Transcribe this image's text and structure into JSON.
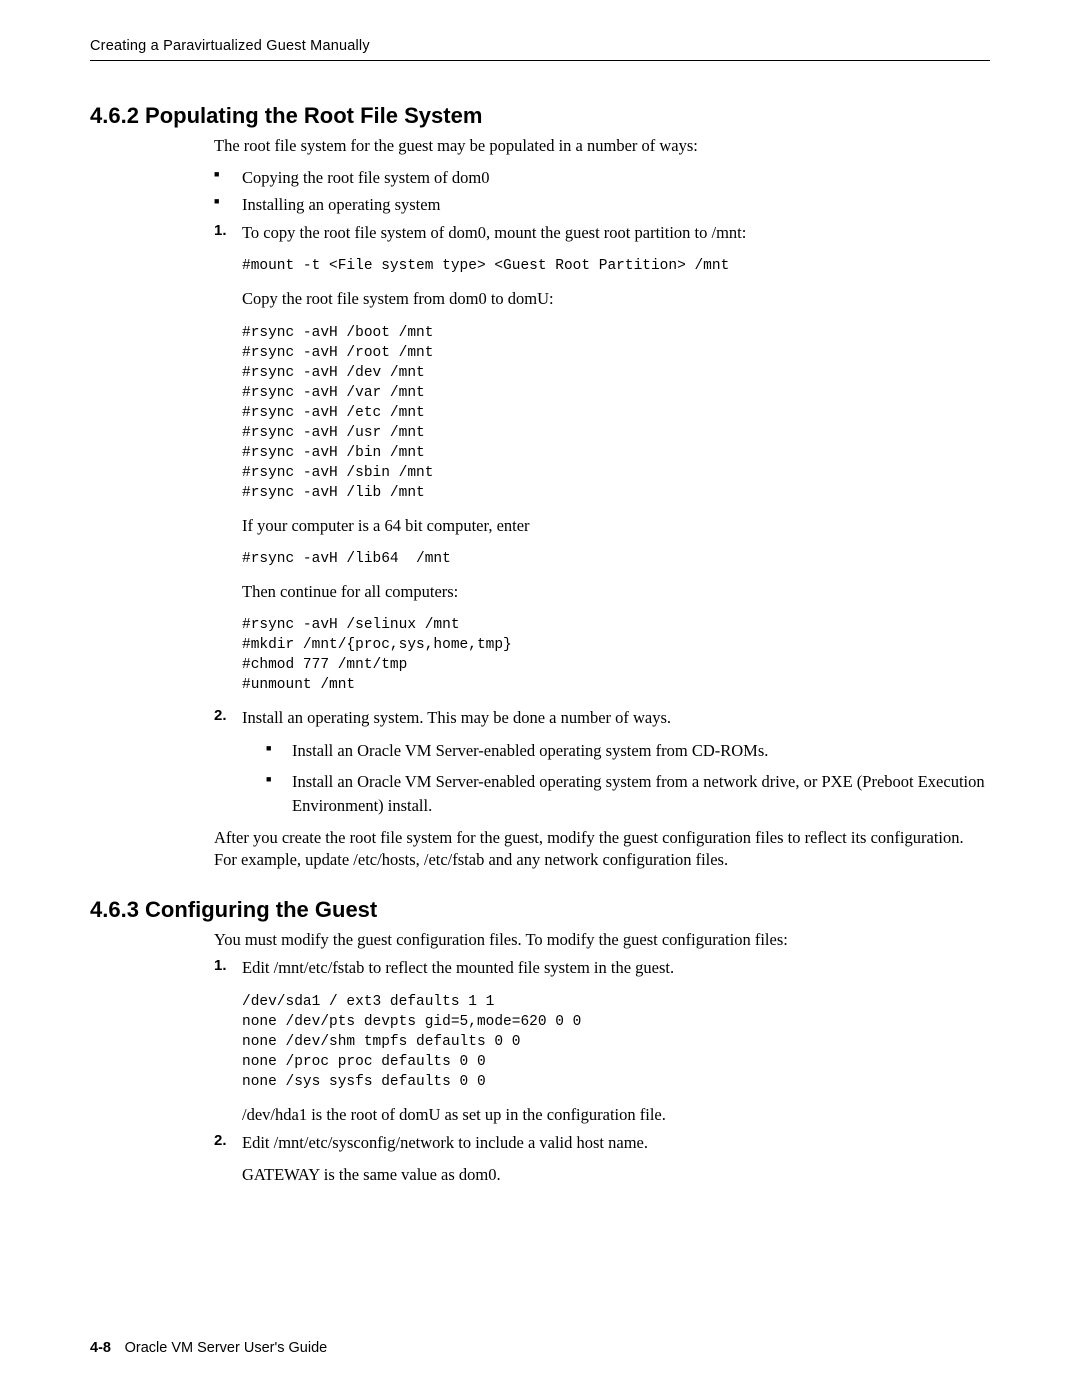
{
  "header": {
    "title": "Creating a Paravirtualized Guest Manually"
  },
  "section1": {
    "heading": "4.6.2 Populating the Root File System",
    "intro": "The root file system for the guest may be populated in a number of ways:",
    "bullets": [
      "Copying the root file system of dom0",
      "Installing an operating system"
    ],
    "step1": {
      "num": "1.",
      "text": "To copy the root file system of dom0, mount the guest root partition to /mnt:",
      "code1": "#mount -t <File system type> <Guest Root Partition> /mnt",
      "para2": "Copy the root file system from dom0 to domU:",
      "code2": "#rsync -avH /boot /mnt\n#rsync -avH /root /mnt\n#rsync -avH /dev /mnt\n#rsync -avH /var /mnt\n#rsync -avH /etc /mnt\n#rsync -avH /usr /mnt\n#rsync -avH /bin /mnt\n#rsync -avH /sbin /mnt\n#rsync -avH /lib /mnt",
      "para3": "If your computer is a 64 bit computer, enter",
      "code3": "#rsync -avH /lib64  /mnt",
      "para4": "Then continue for all computers:",
      "code4": "#rsync -avH /selinux /mnt\n#mkdir /mnt/{proc,sys,home,tmp}\n#chmod 777 /mnt/tmp\n#unmount /mnt"
    },
    "step2": {
      "num": "2.",
      "text": "Install an operating system. This may be done a number of ways.",
      "sub1": "Install an Oracle VM Server-enabled operating system from CD-ROMs.",
      "sub2": "Install an Oracle VM Server-enabled operating system from a network drive, or PXE (Preboot Execution Environment) install."
    },
    "closing": "After you create the root file system for the guest, modify the guest configuration files to reflect its configuration. For example, update /etc/hosts, /etc/fstab and any network configuration files."
  },
  "section2": {
    "heading": "4.6.3 Configuring the Guest",
    "intro": "You must modify the guest configuration files. To modify the guest configuration files:",
    "step1": {
      "num": "1.",
      "text": "Edit /mnt/etc/fstab to reflect the mounted file system in the guest.",
      "code": "/dev/sda1 / ext3 defaults 1 1\nnone /dev/pts devpts gid=5,mode=620 0 0\nnone /dev/shm tmpfs defaults 0 0\nnone /proc proc defaults 0 0\nnone /sys sysfs defaults 0 0",
      "para2": "/dev/hda1 is the root of domU as set up in the configuration file."
    },
    "step2": {
      "num": "2.",
      "text": "Edit /mnt/etc/sysconfig/network to include a valid host name.",
      "para2": "GATEWAY is the same value as dom0."
    }
  },
  "footer": {
    "page": "4-8",
    "guide": "Oracle VM Server User's Guide"
  }
}
